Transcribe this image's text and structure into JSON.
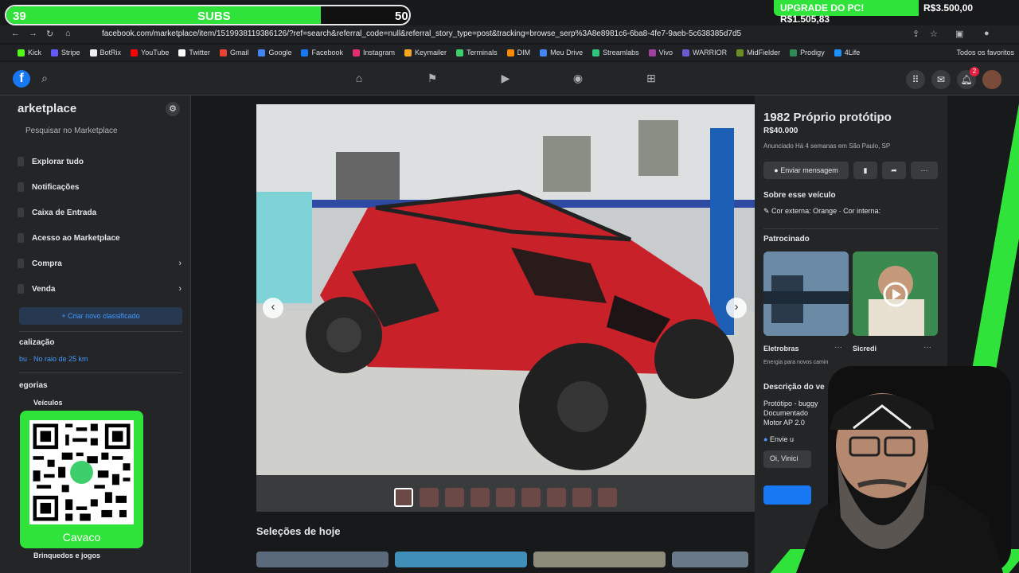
{
  "overlay": {
    "subs_current": "39",
    "subs_label": "SUBS",
    "subs_goal": "50",
    "subs_progress": 0.78,
    "upgrade_label": "UPGRADE DO PC! R$1.505,83",
    "upgrade_goal": "R$3.500,00",
    "qr_name": "Cavaco"
  },
  "browser": {
    "url": "facebook.com/marketplace/item/1519938119386126/?ref=search&referral_code=null&referral_story_type=post&tracking=browse_serp%3A8e8981c6-6ba8-4fe7-9aeb-5c638385d7d5",
    "bookmarks": [
      "Kick",
      "Stripe",
      "BotRix",
      "YouTube",
      "Twitter",
      "Gmail",
      "Google",
      "Facebook",
      "Instagram",
      "Keymailer",
      "Terminals",
      "DIM",
      "Meu Drive",
      "Streamlabs",
      "Vivo",
      "WARRIOR",
      "MidFielder",
      "Prodigy",
      "4Life"
    ],
    "bookmark_folder": "Todos os favoritos"
  },
  "fb": {
    "notif_count": "2"
  },
  "sidebar": {
    "title": "arketplace",
    "search_placeholder": "Pesquisar no Marketplace",
    "items": [
      {
        "label": "Explorar tudo"
      },
      {
        "label": "Notificações"
      },
      {
        "label": "Caixa de Entrada"
      },
      {
        "label": "Acesso ao Marketplace"
      },
      {
        "label": "Compra"
      },
      {
        "label": "Venda"
      }
    ],
    "create_label": "+ Criar novo classificado",
    "location_heading": "calização",
    "location_value": "bu · No raio de 25 km",
    "categories_heading": "egorias",
    "categories": [
      {
        "label": "Veículos"
      },
      {
        "label": "Brinquedos e jogos"
      }
    ]
  },
  "main": {
    "today_heading": "Seleções de hoje"
  },
  "listing": {
    "title": "1982 Próprio protótipo",
    "price": "R$40.000",
    "meta": "Anunciado Há 4 semanas em São Paulo, SP",
    "message_button": "Enviar mensagem",
    "about_heading": "Sobre esse veículo",
    "color_attr": "Cor externa: Orange · Cor interna:",
    "sponsored_heading": "Patrocinado",
    "sponsors": [
      {
        "name": "Eletrobras",
        "desc": "Energia para novos camin"
      },
      {
        "name": "Sicredi",
        "desc": ""
      }
    ],
    "description_heading": "Descrição do ve",
    "description_lines": [
      "Protótipo - buggy",
      "Documentado",
      "Motor AP 2.0"
    ],
    "send_prompt": "Envie u",
    "message_draft": "Oi, Vinici"
  },
  "colors": {
    "stream_green": "#2fe33a",
    "fb_blue": "#1877f2",
    "fb_surface": "#242526",
    "fb_bg": "#18191a"
  }
}
